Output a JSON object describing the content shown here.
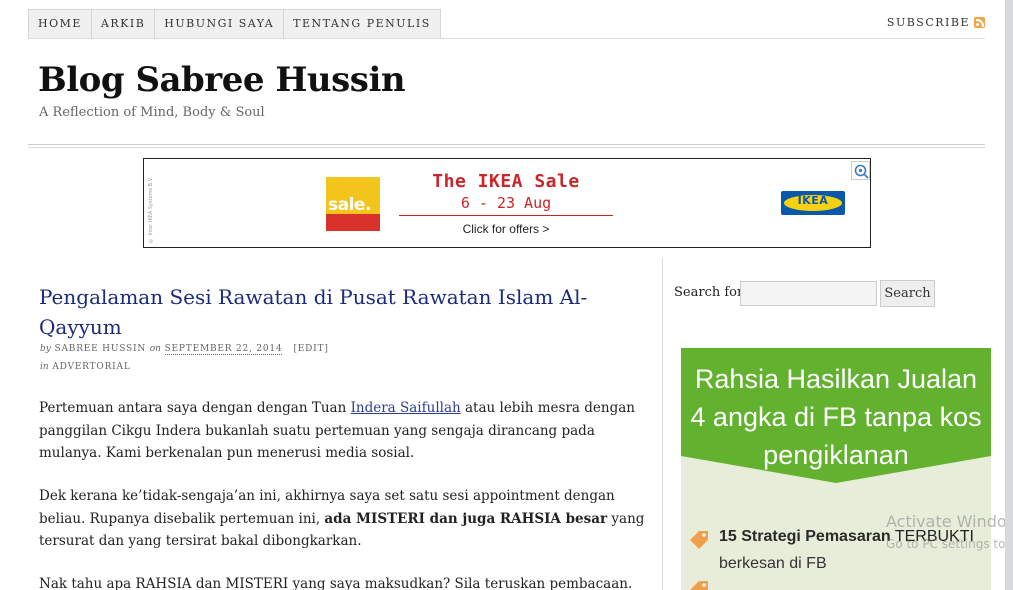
{
  "nav": {
    "items": [
      {
        "label": "HOME"
      },
      {
        "label": "ARKIB"
      },
      {
        "label": "HUBUNGI SAYA"
      },
      {
        "label": "TENTANG PENULIS"
      }
    ],
    "subscribe_label": "SUBSCRIBE",
    "subscribe_icon": "rss-icon"
  },
  "header": {
    "title": "Blog Sabree Hussin",
    "tagline": "A Reflection of Mind, Body & Soul"
  },
  "ad": {
    "badge_text": "sale.",
    "headline": "The IKEA Sale",
    "dates": "6 - 23 Aug",
    "cta": "Click for offers  >",
    "brand": "IKEA",
    "colors": {
      "red": "#c9262a",
      "yellow": "#f3c41c",
      "blue": "#0a58a8"
    }
  },
  "post": {
    "title": "Pengalaman Sesi Rawatan di Pusat Rawatan Islam Al-Qayyum",
    "by": "by",
    "author": "Sabree Hussin",
    "on": "on",
    "date": "September 22, 2014",
    "edit": "[Edit]",
    "in": "in",
    "category": "Advertorial",
    "p1_before": "Pertemuan antara saya dengan dengan Tuan ",
    "p1_link": "Indera Saifullah",
    "p1_after": " atau lebih mesra dengan panggilan Cikgu Indera bukanlah suatu pertemuan yang sengaja dirancang pada mulanya. Kami berkenalan pun menerusi media sosial.",
    "p2_before": "Dek kerana ke’tidak-sengaja’an ini, akhirnya saya set satu sesi appointment dengan beliau. Rupanya disebalik pertemuan ini, ",
    "p2_bold": "ada MISTERI dan juga RAHSIA besar",
    "p2_after": " yang tersurat dan yang tersirat bakal dibongkarkan.",
    "p3": "Nak tahu apa RAHSIA dan MISTERI yang saya maksudkan? Sila teruskan pembacaan."
  },
  "sidebar": {
    "search_label": "Search for:",
    "search_value": "",
    "search_button": "Search",
    "promo": {
      "title": "Rahsia Hasilkan Jualan 4 angka di FB tanpa kos pengiklanan",
      "item1_bold": "15 Strategi Pemasaran",
      "item1_rest": " TERBUKTI",
      "item1_line2": "berkesan di FB",
      "colors": {
        "green": "#63b22f",
        "bg": "#e8edda",
        "tag": "#f0a04b"
      }
    }
  },
  "watermark": {
    "line1": "Activate Windows",
    "line2": "Go to PC settings to activate Windows."
  }
}
